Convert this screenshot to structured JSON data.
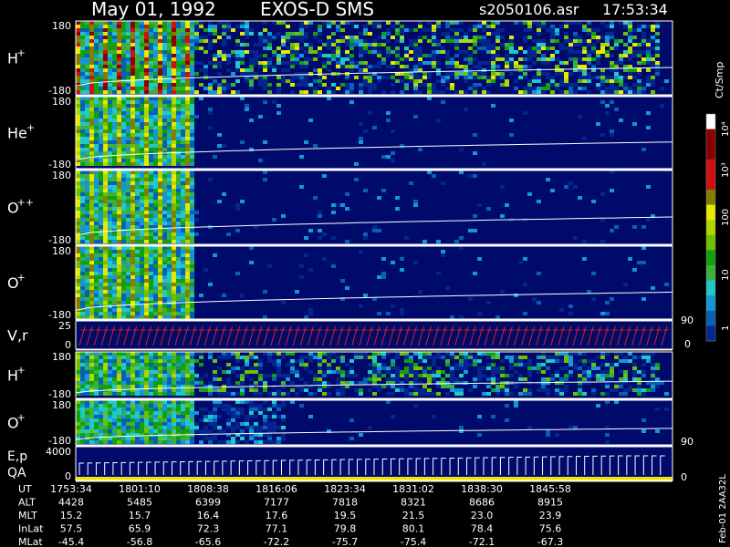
{
  "header": {
    "date": "May 01, 1992",
    "instrument": "EXOS-D SMS",
    "file": "s2050106.asr",
    "time": "17:53:34"
  },
  "colorbar": {
    "unit": "Ct/Smp",
    "tick_labels": [
      "10⁴",
      "10³",
      "100",
      "10",
      "1"
    ],
    "colors": [
      "#000a6a",
      "#04258e",
      "#0760b8",
      "#1596d6",
      "#20c8c8",
      "#3cb03c",
      "#10a010",
      "#70c000",
      "#b0d800",
      "#e8e800",
      "#808000",
      "#d01010",
      "#8c0000",
      "#ffffff"
    ]
  },
  "chart_data": {
    "type": "heatmap",
    "title": "May 01, 1992 EXOS-D SMS",
    "panels": [
      {
        "name": "H",
        "sup": "+",
        "ylim": [
          -180,
          180
        ],
        "ytick_labels": [
          "180",
          "-180"
        ],
        "max_level": 9,
        "early_level": 12,
        "cutoff": 0.98
      },
      {
        "name": "He",
        "sup": "+",
        "ylim": [
          -180,
          180
        ],
        "ytick_labels": [
          "180",
          "-180"
        ],
        "max_level": 4,
        "early_level": 10,
        "cutoff": 0.2
      },
      {
        "name": "O",
        "sup": "++",
        "ylim": [
          -180,
          180
        ],
        "ytick_labels": [
          "180",
          "-180"
        ],
        "max_level": 4,
        "early_level": 10,
        "cutoff": 0.2
      },
      {
        "name": "O",
        "sup": "+",
        "ylim": [
          -180,
          180
        ],
        "ytick_labels": [
          "180",
          "-180"
        ],
        "max_level": 4,
        "early_level": 10,
        "cutoff": 0.2
      },
      {
        "name": "V,r",
        "sup": "",
        "ylim": [
          0,
          25
        ],
        "ytick_labels": [
          "25",
          "0"
        ],
        "right_tick_labels": [
          "90",
          "0"
        ]
      },
      {
        "name": "H",
        "sup": "+",
        "ylim": [
          -180,
          180
        ],
        "ytick_labels": [
          "180",
          "-180"
        ],
        "max_level": 7,
        "early_level": 8,
        "cutoff": 0.98
      },
      {
        "name": "O",
        "sup": "+",
        "ylim": [
          -180,
          180
        ],
        "ytick_labels": [
          "180",
          "-180"
        ],
        "max_level": 4,
        "early_level": 7,
        "cutoff": 0.35,
        "right_tick_labels": [
          "90"
        ]
      },
      {
        "name": "E,p",
        "sup": "",
        "name2": "QA",
        "ylim": [
          0,
          4000
        ],
        "ytick_labels": [
          "4000",
          "0"
        ],
        "right_tick_labels": [
          "0"
        ]
      }
    ],
    "ephemeris": {
      "row_labels": [
        "UT",
        "ALT",
        "MLT",
        "InLat",
        "MLat"
      ],
      "columns": [
        {
          "UT": "1753:34",
          "ALT": "4428",
          "MLT": "15.2",
          "InLat": "57.5",
          "MLat": "-45.4"
        },
        {
          "UT": "1801:10",
          "ALT": "5485",
          "MLT": "15.7",
          "InLat": "65.9",
          "MLat": "-56.8"
        },
        {
          "UT": "1808:38",
          "ALT": "6399",
          "MLT": "16.4",
          "InLat": "72.3",
          "MLat": "-65.6"
        },
        {
          "UT": "1816:06",
          "ALT": "7177",
          "MLT": "17.6",
          "InLat": "77.1",
          "MLat": "-72.2"
        },
        {
          "UT": "1823:34",
          "ALT": "7818",
          "MLT": "19.5",
          "InLat": "79.8",
          "MLat": "-75.7"
        },
        {
          "UT": "1831:02",
          "ALT": "8321",
          "MLT": "21.5",
          "InLat": "80.1",
          "MLat": "-75.4"
        },
        {
          "UT": "1838:30",
          "ALT": "8686",
          "MLT": "23.0",
          "InLat": "78.4",
          "MLat": "-72.1"
        },
        {
          "UT": "1845:58",
          "ALT": "8915",
          "MLT": "23.9",
          "InLat": "75.6",
          "MLat": "-67.3"
        }
      ]
    },
    "side_label": "Feb-01 2AA32L"
  }
}
